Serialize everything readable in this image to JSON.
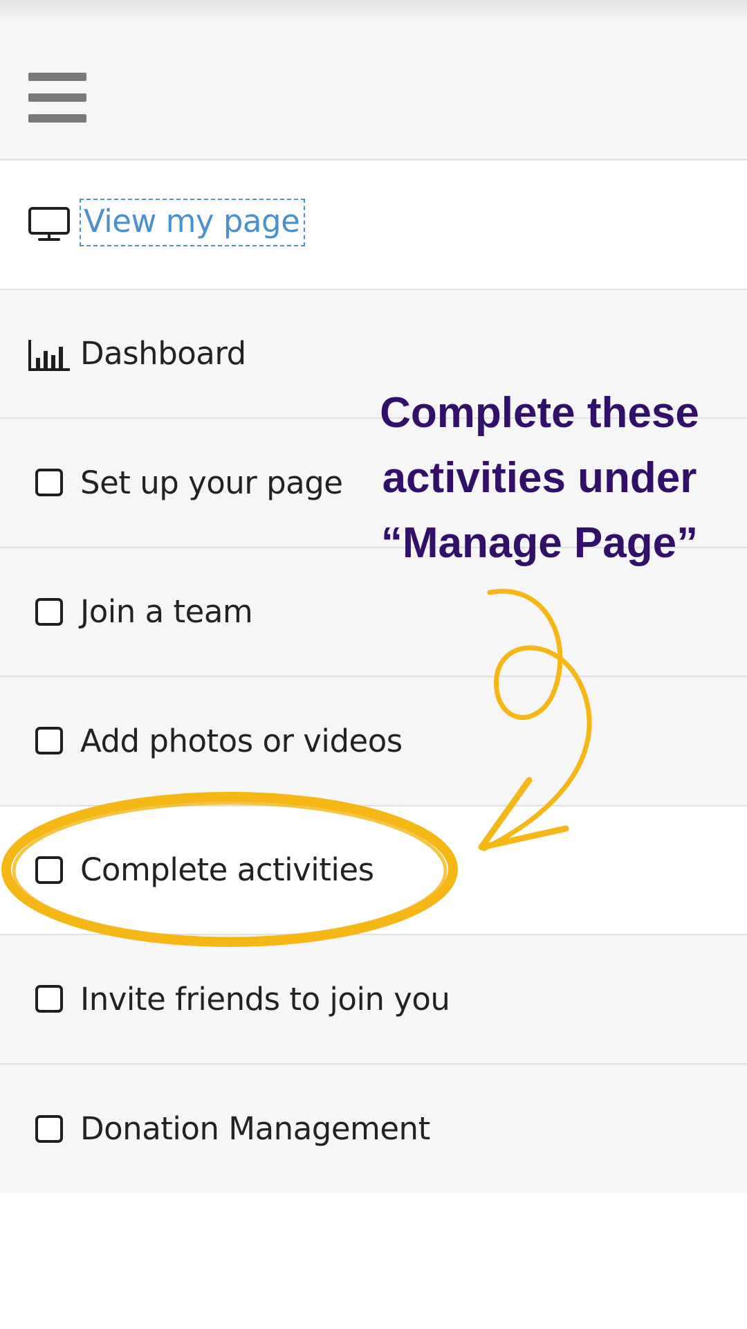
{
  "header": {
    "menu_icon": "hamburger-icon"
  },
  "menu": {
    "items": [
      {
        "label": "View my page",
        "icon": "monitor-icon",
        "style": "link"
      },
      {
        "label": "Dashboard",
        "icon": "bar-chart-icon"
      },
      {
        "label": "Set up your page",
        "icon": "checkbox-icon",
        "checked": false
      },
      {
        "label": "Join a team",
        "icon": "checkbox-icon",
        "checked": false
      },
      {
        "label": "Add photos or videos",
        "icon": "checkbox-icon",
        "checked": false
      },
      {
        "label": "Complete activities",
        "icon": "checkbox-icon",
        "checked": false,
        "highlighted": true
      },
      {
        "label": "Invite friends to join you",
        "icon": "checkbox-icon",
        "checked": false
      },
      {
        "label": "Donation Management",
        "icon": "checkbox-icon",
        "checked": false
      }
    ]
  },
  "annotation": {
    "lines": [
      "Complete these",
      "activities under",
      "“Manage Page”"
    ],
    "text_color": "#32106a",
    "highlight_color": "#f5b716"
  },
  "colors": {
    "link": "#4a8fd0",
    "row_gray": "#f6f6f6",
    "row_white": "#ffffff",
    "divider": "#e0e0e0"
  }
}
